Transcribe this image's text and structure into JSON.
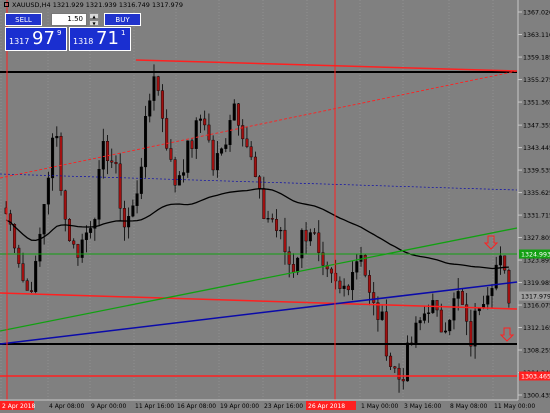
{
  "header": {
    "symbol_line": "XAUUSD,H4  1321.929 1321.939 1316.749 1317.979"
  },
  "trade_panel": {
    "sell_label": "SELL",
    "buy_label": "BUY",
    "lot_value": "1.50",
    "bid": {
      "small": "1317",
      "big": "97",
      "sup": "9"
    },
    "ask": {
      "small": "1318",
      "big": "71",
      "sup": "1"
    }
  },
  "colors": {
    "background": "#808080",
    "up_candle": "#000000",
    "down_candle": "#a01010",
    "red_line": "#ff2020",
    "green_line": "#12a012",
    "blue_line": "#0a0aaa",
    "ma_line": "#000000",
    "panel_blue": "#1a2fd0"
  },
  "chart_data": {
    "type": "candlestick",
    "y_axis_ticks": [
      "1367.020",
      "1363.110",
      "1359.185",
      "1355.275",
      "1351.365",
      "1347.355",
      "1343.445",
      "1339.535",
      "1335.625",
      "1331.715",
      "1327.805",
      "1323.895",
      "1319.985",
      "1316.075",
      "1312.165",
      "1308.255",
      "1304.345",
      "1300.435"
    ],
    "price_tags": [
      {
        "text": "1324.993",
        "color": "#12a012"
      },
      {
        "text": "1317.979",
        "color": "#a0a0a0"
      },
      {
        "text": "1303.465",
        "color": "#ff2020"
      }
    ],
    "x_axis_labels": [
      "2 Apr 2018",
      "4 Apr 08:00",
      "9 Apr 00:00",
      "11 Apr 16:00",
      "16 Apr 08:00",
      "19 Apr 00:00",
      "23 Apr 16:00",
      "26 Apr 2018",
      "1 May 00:00",
      "3 May 16:00",
      "8 May 08:00",
      "11 May 00:00"
    ],
    "x_axis_highlight": [
      "2 Apr 2018",
      "26 Apr 2018"
    ],
    "y_min": 1300.435,
    "y_max": 1367.02,
    "close_path": [
      1332,
      1327,
      1318,
      1322,
      1336,
      1347,
      1331,
      1325,
      1328,
      1333,
      1344,
      1340,
      1330,
      1333,
      1345,
      1357,
      1348,
      1337,
      1341,
      1345,
      1350,
      1340,
      1343,
      1352,
      1347,
      1340,
      1332,
      1331,
      1327,
      1322,
      1328,
      1330,
      1321,
      1320,
      1318,
      1322,
      1326,
      1316,
      1314,
      1306,
      1303,
      1309,
      1313,
      1317,
      1312,
      1315,
      1318,
      1309,
      1317,
      1320,
      1324,
      1318
    ],
    "annotations": [
      "down-arrow",
      "down-arrow"
    ]
  }
}
